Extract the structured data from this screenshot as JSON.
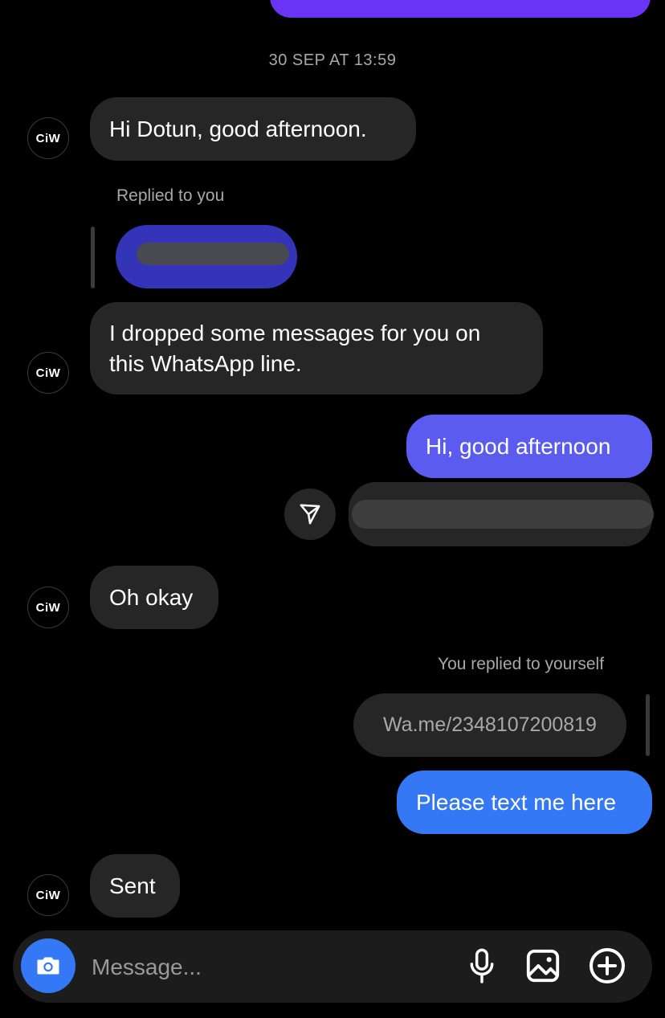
{
  "timestamp": "30 SEP AT 13:59",
  "contact_avatar_text": "CiW",
  "messages": {
    "m1": "Hi Dotun, good afternoon.",
    "reply_label_1": "Replied to you",
    "m2_line1": "I dropped some messages for you on",
    "m2_line2": "this WhatsApp line.",
    "m3": "Hi, good afternoon",
    "m4": "Oh okay",
    "reply_label_2": "You replied to yourself",
    "quoted_link": "Wa.me/2348107200819",
    "m5": "Please text me here",
    "m6": "Sent"
  },
  "composer": {
    "placeholder": "Message..."
  },
  "icons": {
    "camera": "camera-icon",
    "mic": "microphone-icon",
    "gallery": "image-icon",
    "plus": "plus-icon",
    "share": "send-icon"
  },
  "colors": {
    "background": "#000000",
    "incoming_bubble": "#262626",
    "outgoing_blue": "#3478f6",
    "outgoing_indigo": "#5b5bf0",
    "top_bubble": "#6a34f5"
  }
}
